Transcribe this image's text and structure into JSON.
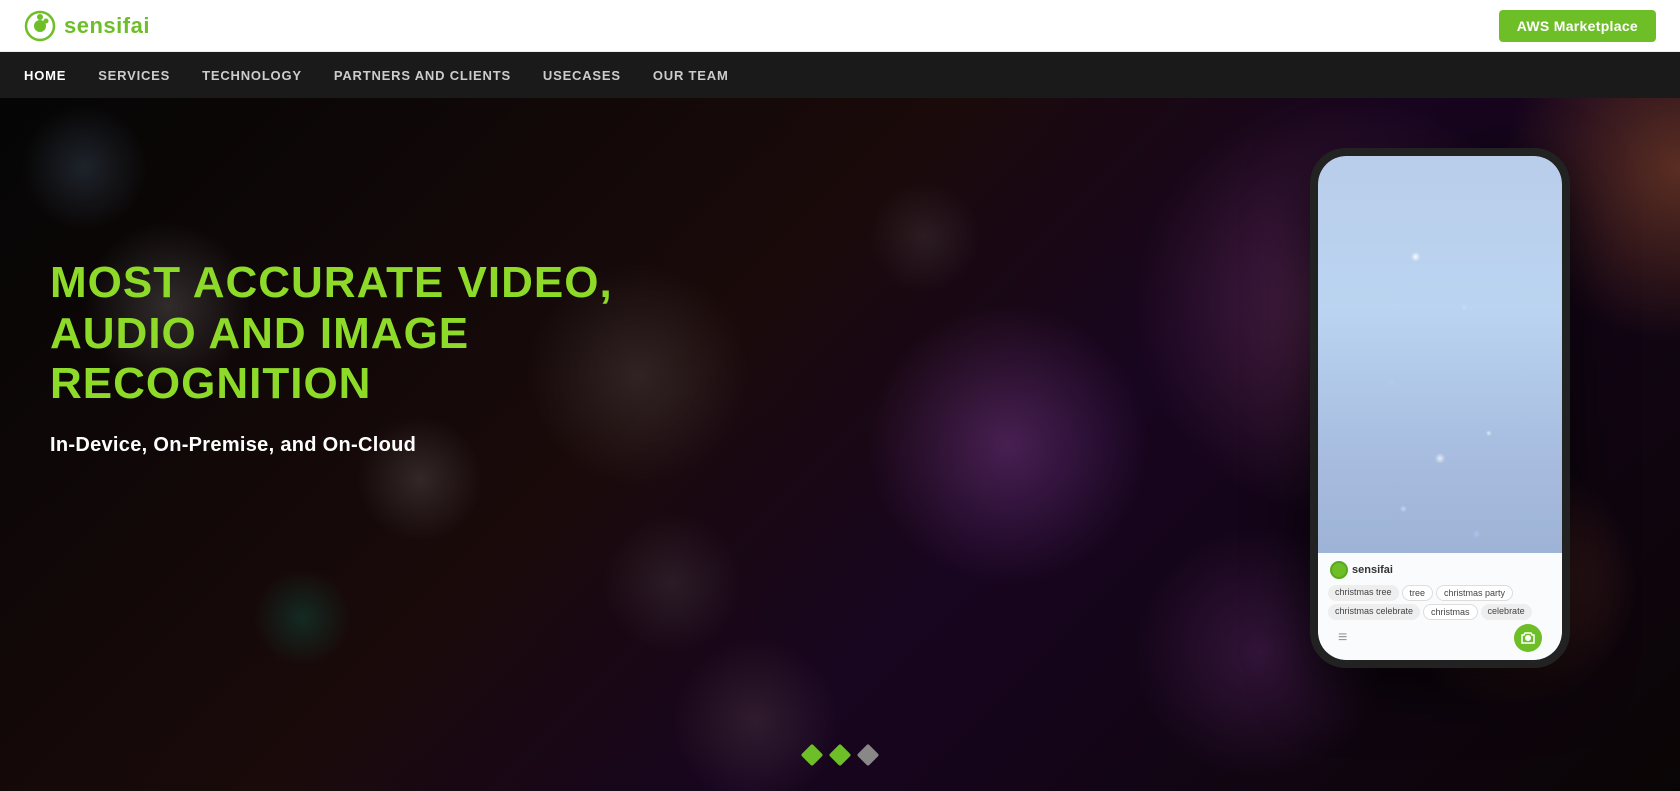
{
  "brand": {
    "name_start": "sensif",
    "name_end": "ai",
    "logo_icon": "●"
  },
  "header": {
    "aws_button_label": "AWS Marketplace"
  },
  "nav": {
    "items": [
      {
        "label": "HOME",
        "active": true
      },
      {
        "label": "SERVICES",
        "active": false
      },
      {
        "label": "TECHNOLOGY",
        "active": false
      },
      {
        "label": "PARTNERS AND CLIENTS",
        "active": false
      },
      {
        "label": "USECASES",
        "active": false
      },
      {
        "label": "OUR TEAM",
        "active": false
      }
    ]
  },
  "hero": {
    "title": "MOST ACCURATE VIDEO, AUDIO AND IMAGE RECOGNITION",
    "subtitle": "In-Device, On-Premise, and On-Cloud"
  },
  "phone": {
    "logo_text": "sensifai",
    "tags": [
      "christmas tree",
      "tree",
      "christmas party",
      "christmas celebrate",
      "christmas",
      "celebrate"
    ]
  },
  "slider": {
    "dots": [
      {
        "active": true
      },
      {
        "active": true
      },
      {
        "active": false
      }
    ]
  },
  "colors": {
    "green": "#6ebe28",
    "dark_nav": "#1a1a1a",
    "white": "#ffffff"
  }
}
